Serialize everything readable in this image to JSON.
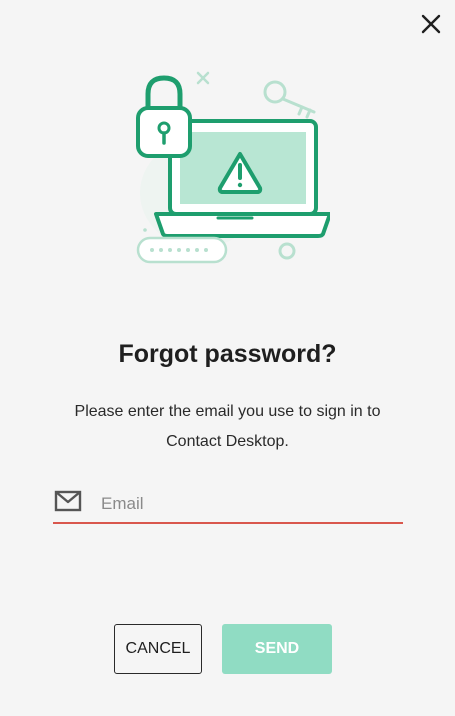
{
  "dialog": {
    "title": "Forgot password?",
    "description": "Please enter the email you use to sign in to Contact Desktop.",
    "email": {
      "value": "",
      "placeholder": "Email",
      "icon": "envelope-icon"
    },
    "close_icon": "close-icon",
    "buttons": {
      "cancel_label": "CANCEL",
      "send_label": "SEND"
    },
    "illustration": "locked-laptop-illustration"
  },
  "colors": {
    "accent_green": "#1e9e6e",
    "light_green": "#b8e6d3",
    "send_button_disabled": "#90dcc3",
    "input_underline_error": "#d9574d",
    "background": "#f5f5f5"
  }
}
